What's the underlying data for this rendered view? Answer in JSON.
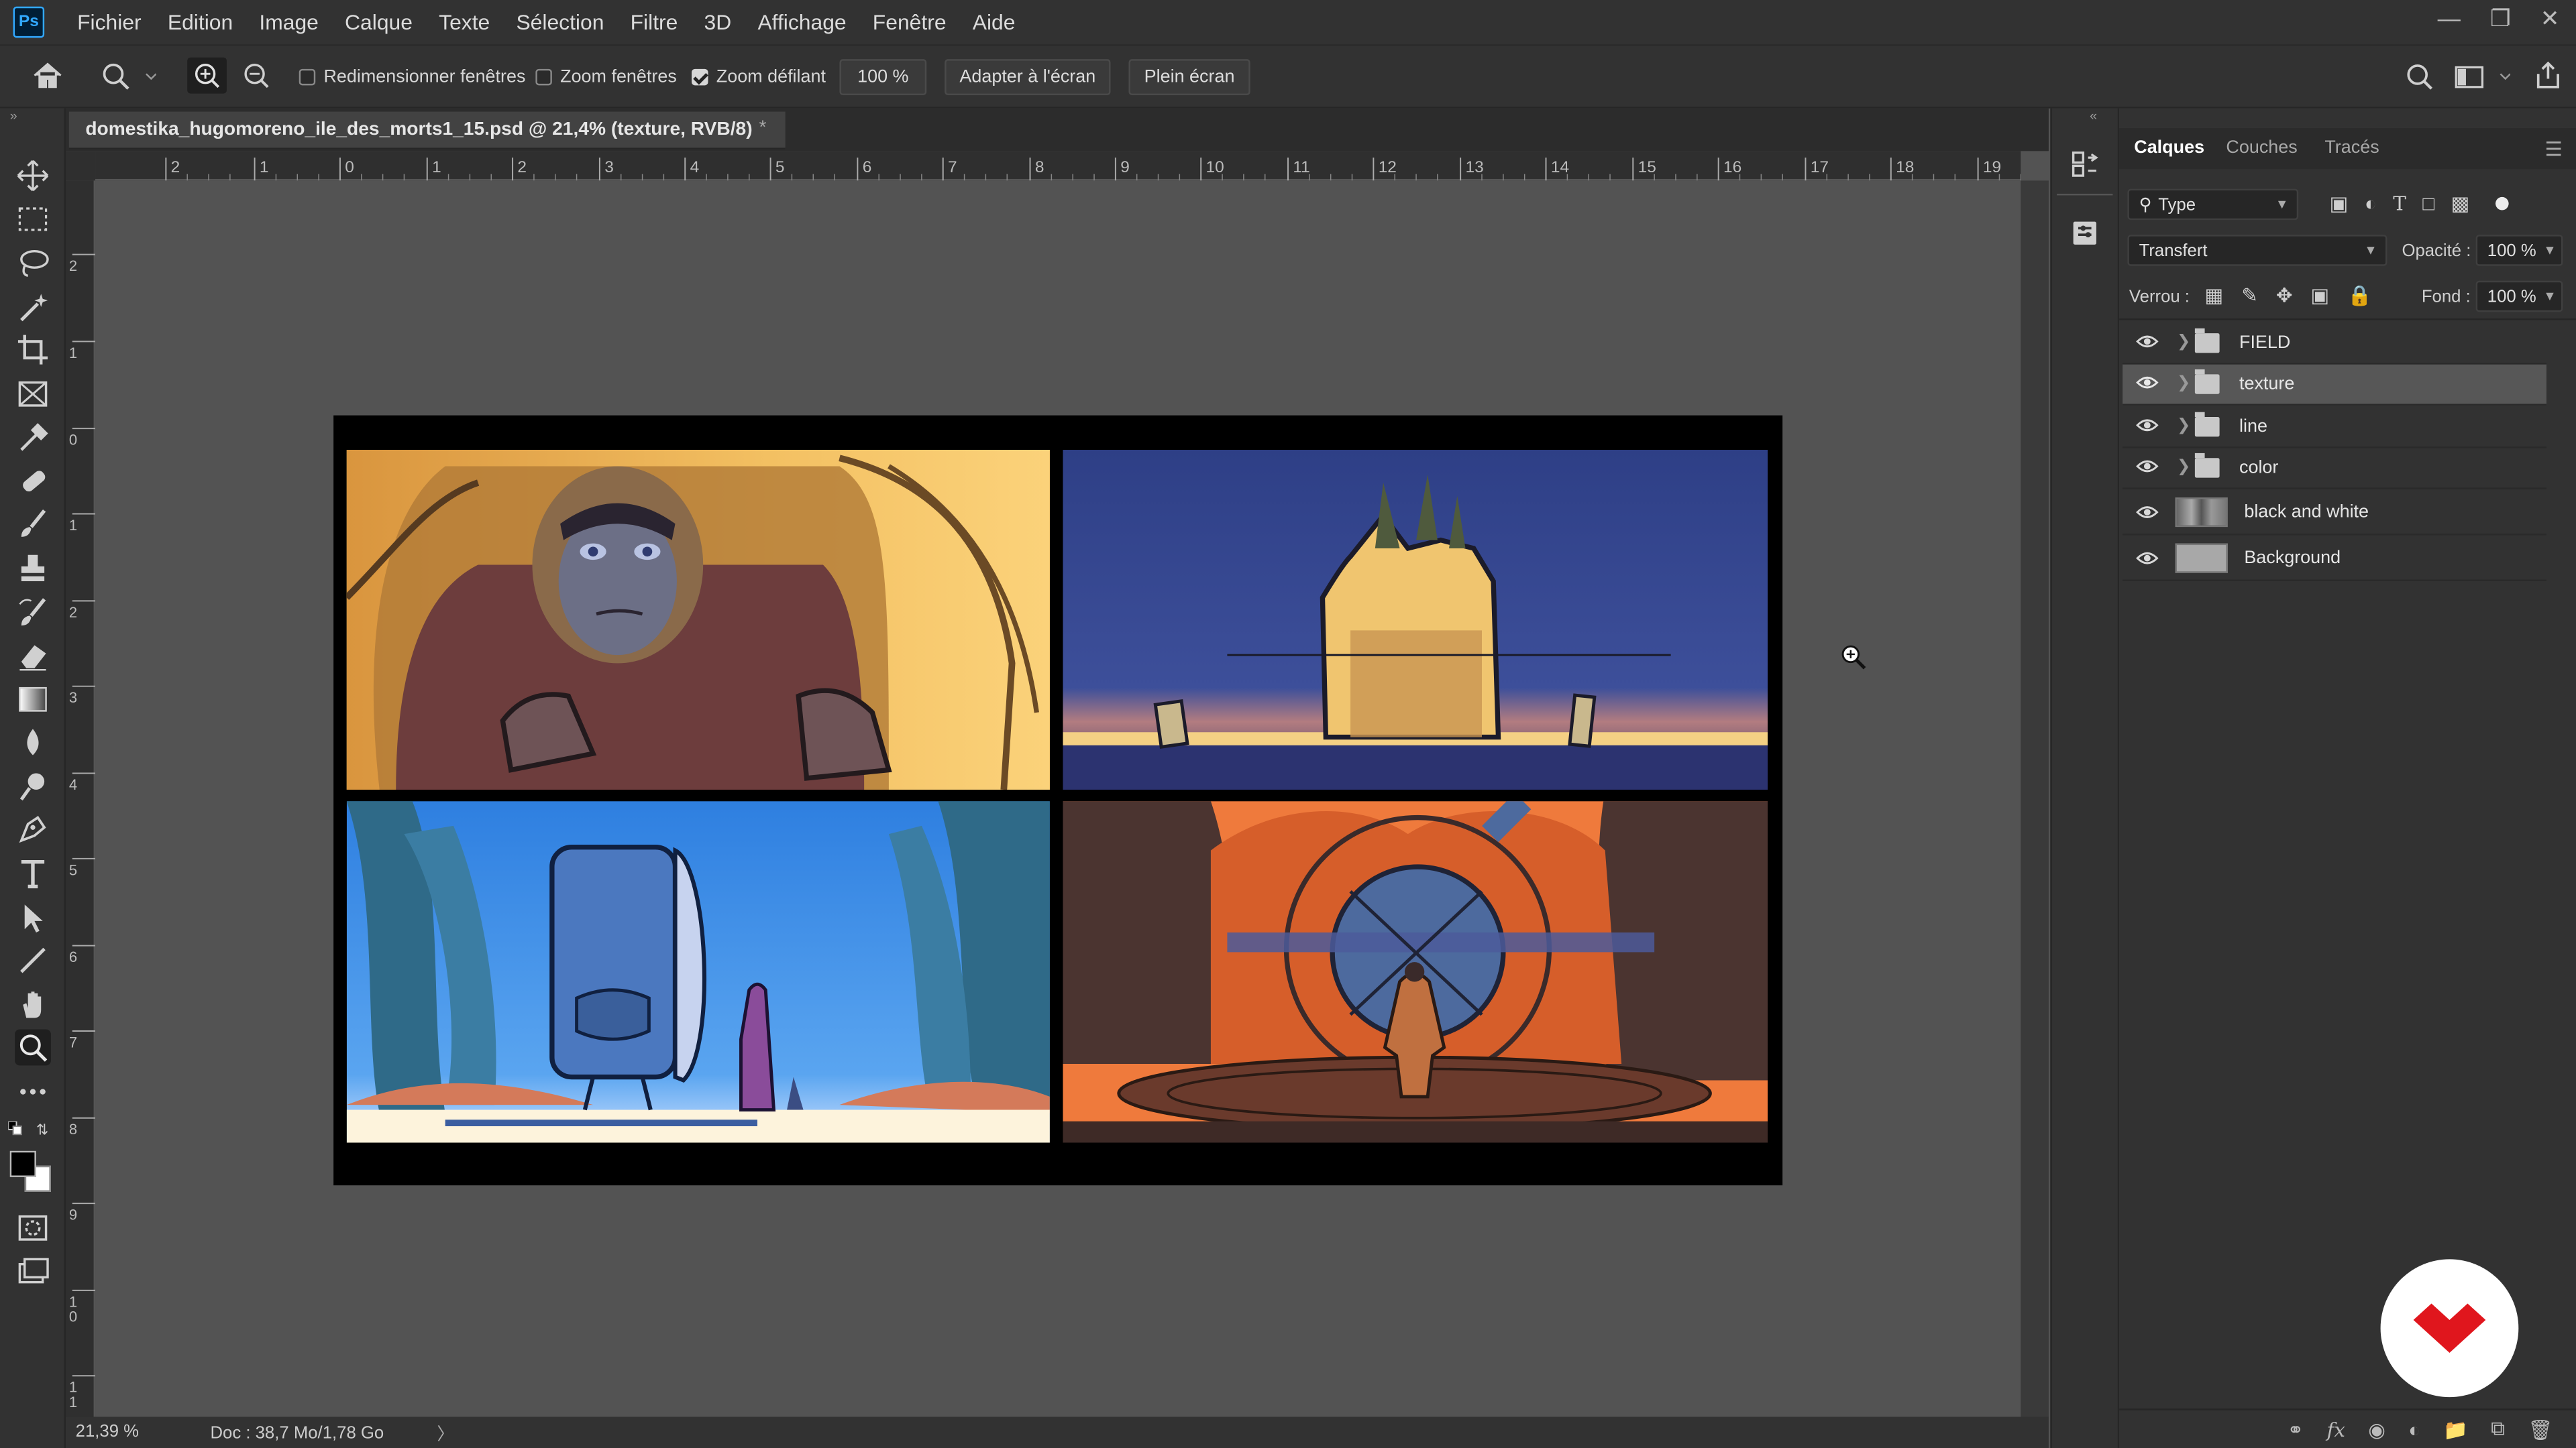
{
  "app": {
    "logo": "Ps"
  },
  "menu": [
    "Fichier",
    "Edition",
    "Image",
    "Calque",
    "Texte",
    "Sélection",
    "Filtre",
    "3D",
    "Affichage",
    "Fenêtre",
    "Aide"
  ],
  "options": {
    "resize_windows": "Redimensionner fenêtres",
    "zoom_windows": "Zoom fenêtres",
    "scrubby_zoom": "Zoom défilant",
    "zoom_value": "100 %",
    "fit_screen": "Adapter à l'écran",
    "full_screen": "Plein écran"
  },
  "document": {
    "tab_title": "domestika_hugomoreno_ile_des_morts1_15.psd @ 21,4% (texture, RVB/8)",
    "tab_suffix": "*"
  },
  "ruler": {
    "h_ticks": [
      "2",
      "1",
      "0",
      "1",
      "2",
      "3",
      "4",
      "5",
      "6",
      "7",
      "8",
      "9",
      "10",
      "11",
      "12",
      "13",
      "14",
      "15",
      "16",
      "17",
      "18",
      "19"
    ],
    "v_ticks": [
      "2",
      "1",
      "0",
      "1",
      "2",
      "3",
      "4",
      "5",
      "6",
      "7",
      "8",
      "9",
      "1 0",
      "1 1"
    ]
  },
  "status": {
    "zoom": "21,39 %",
    "doc": "Doc : 38,7 Mo/1,78 Go",
    "arrow": "〉"
  },
  "panel": {
    "tabs": [
      "Calques",
      "Couches",
      "Tracés"
    ],
    "filter_type": "Type",
    "blend_mode": "Transfert",
    "opacity_label": "Opacité :",
    "opacity_value": "100 %",
    "lock_label": "Verrou :",
    "fill_label": "Fond :",
    "fill_value": "100 %"
  },
  "layers": [
    {
      "name": "FIELD",
      "kind": "group"
    },
    {
      "name": "texture",
      "kind": "group",
      "selected": true
    },
    {
      "name": "line",
      "kind": "group"
    },
    {
      "name": "color",
      "kind": "group"
    },
    {
      "name": "black and white",
      "kind": "pixel"
    },
    {
      "name": "Background",
      "kind": "background"
    }
  ],
  "colors": {
    "accent": "#31a8ff",
    "brand": "#e0161d"
  }
}
